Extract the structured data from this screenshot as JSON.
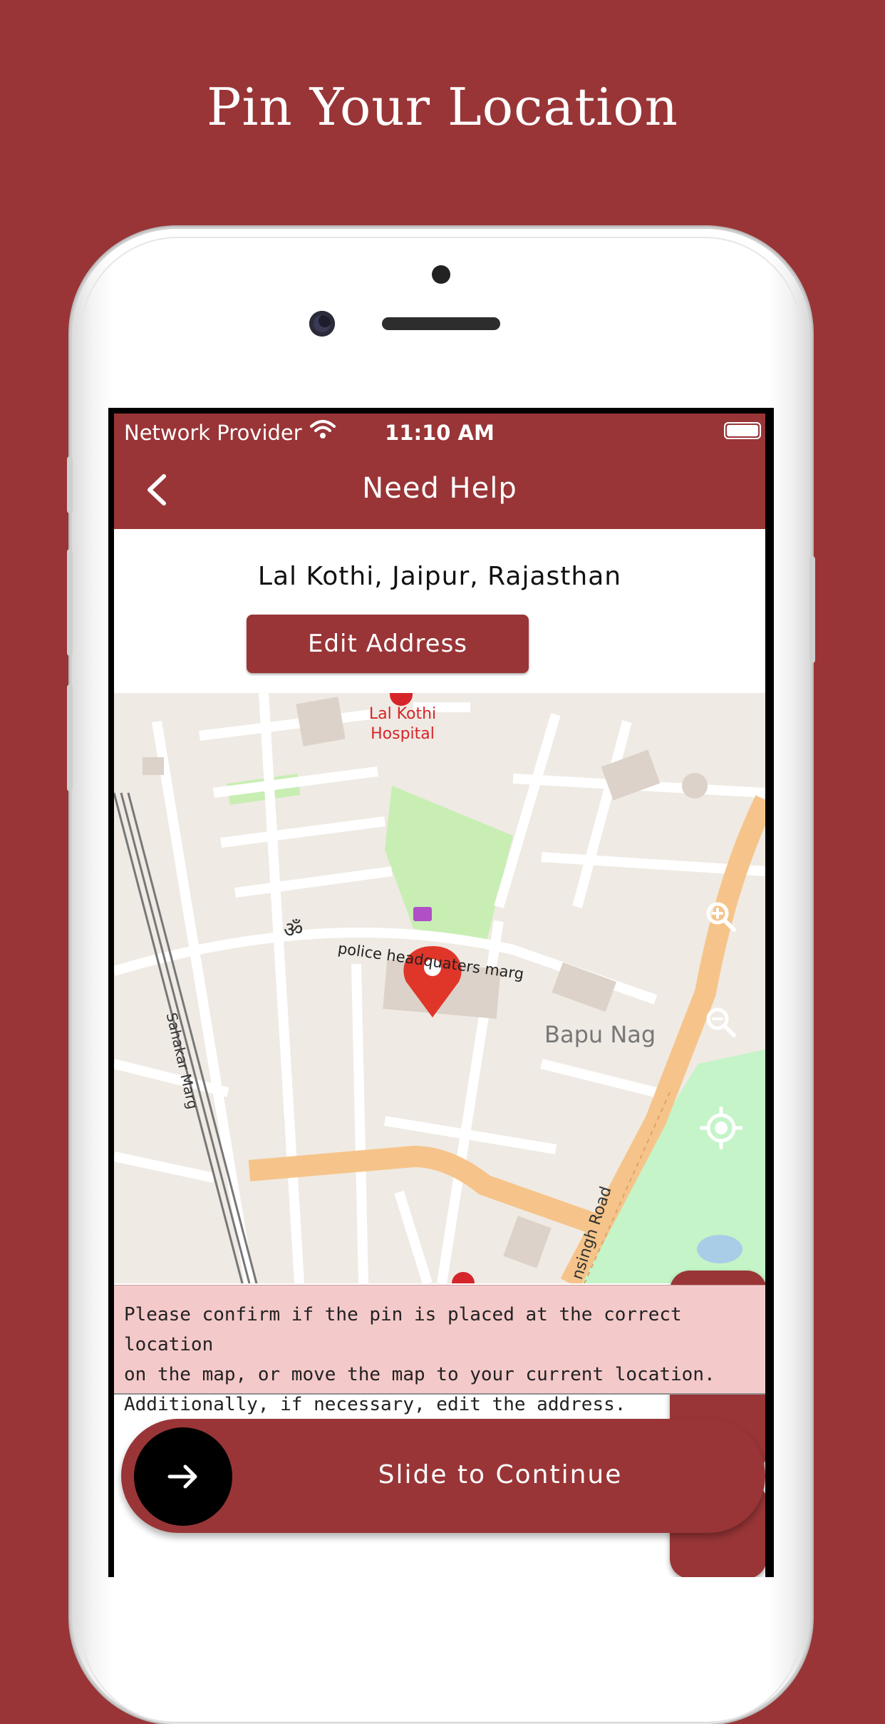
{
  "headline": "Pin Your Location",
  "status_bar": {
    "carrier": "Network Provider",
    "time": "11:10 AM"
  },
  "navbar": {
    "title": "Need Help"
  },
  "address": "Lal Kothi, Jaipur, Rajasthan",
  "edit_button": "Edit Address",
  "map": {
    "labels": {
      "hospital_1": "Lal Kothi",
      "hospital_2": "Hospital",
      "road_police": "police headquaters marg",
      "road_sahakar": "Sahakar Marg",
      "area_bapu": "Bapu Nag",
      "road_bottom": "nsingh Road"
    },
    "pin_color": "#e0362a"
  },
  "controls": {
    "zoom_in": "zoom-in-icon",
    "zoom_out": "zoom-out-icon",
    "locate": "my-location-icon"
  },
  "notice": {
    "line1": "Please confirm if the pin is placed at the correct location",
    "line2": "on the map, or move the map to your current location.",
    "line3": "Additionally, if necessary, edit the address."
  },
  "slider": {
    "label": "Slide to Continue"
  },
  "colors": {
    "brand": "#993537",
    "notice_bg": "#f4c9ca"
  }
}
